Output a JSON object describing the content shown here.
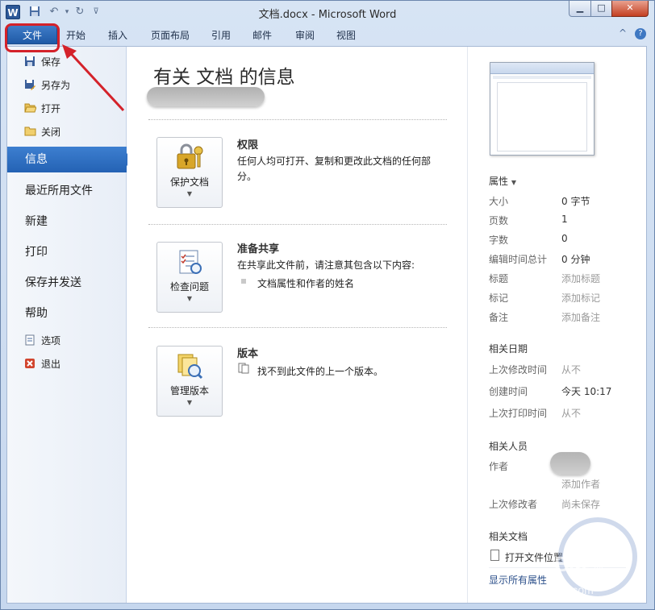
{
  "window": {
    "title": "文档.docx  -  Microsoft Word",
    "app_icon": "W",
    "qat": {
      "save_icon": "save-icon",
      "undo_icon": "undo-icon",
      "redo_icon": "redo-icon"
    },
    "controls": {
      "minimize": "▁",
      "maximize": "□",
      "close": "✕"
    }
  },
  "ribbon": {
    "tabs": [
      "文件",
      "开始",
      "插入",
      "页面布局",
      "引用",
      "邮件",
      "审阅",
      "视图"
    ],
    "help_glyph": "?",
    "collapse_glyph": "^"
  },
  "nav": {
    "small_items_top": [
      {
        "label": "保存",
        "icon": "save-icon"
      },
      {
        "label": "另存为",
        "icon": "save-as-icon"
      },
      {
        "label": "打开",
        "icon": "open-folder-icon"
      },
      {
        "label": "关闭",
        "icon": "close-folder-icon"
      }
    ],
    "big_items": [
      "信息",
      "最近所用文件",
      "新建",
      "打印",
      "保存并发送",
      "帮助"
    ],
    "active_item": "信息",
    "small_items_bottom": [
      {
        "label": "选项",
        "icon": "options-icon"
      },
      {
        "label": "退出",
        "icon": "exit-icon"
      }
    ]
  },
  "info": {
    "title": "有关 文档 的信息",
    "sections": [
      {
        "button_label": "保护文档",
        "icon": "lock-key-icon",
        "heading": "权限",
        "desc": "任何人均可打开、复制和更改此文档的任何部分。"
      },
      {
        "button_label": "检查问题",
        "icon": "checklist-icon",
        "heading": "准备共享",
        "desc": "在共享此文件前，请注意其包含以下内容:",
        "items": [
          "文档属性和作者的姓名"
        ]
      },
      {
        "button_label": "管理版本",
        "icon": "versions-icon",
        "heading": "版本",
        "desc": "找不到此文件的上一个版本。"
      }
    ]
  },
  "props": {
    "header": "属性",
    "rows": [
      {
        "label": "大小",
        "value": "0 字节",
        "muted": false
      },
      {
        "label": "页数",
        "value": "1",
        "muted": false
      },
      {
        "label": "字数",
        "value": "0",
        "muted": false
      },
      {
        "label": "编辑时间总计",
        "value": "0 分钟",
        "muted": false
      },
      {
        "label": "标题",
        "value": "添加标题",
        "muted": true
      },
      {
        "label": "标记",
        "value": "添加标记",
        "muted": true
      },
      {
        "label": "备注",
        "value": "添加备注",
        "muted": true
      }
    ],
    "dates_header": "相关日期",
    "dates": [
      {
        "label": "上次修改时间",
        "value": "从不",
        "muted": true
      },
      {
        "label": "创建时间",
        "value": "今天 10:17",
        "muted": false
      },
      {
        "label": "上次打印时间",
        "value": "从不",
        "muted": true
      }
    ],
    "people_header": "相关人员",
    "author_label": "作者",
    "add_author": "添加作者",
    "last_modified_by_label": "上次修改者",
    "last_modified_by_value": "尚未保存",
    "docs_header": "相关文档",
    "open_location": "打开文件位置",
    "show_all": "显示所有属性"
  },
  "watermark": {
    "text1": "Bai",
    "text2": "经验",
    "text3": "jingyan.baidu.com"
  },
  "colors": {
    "accent": "#2b66b8",
    "highlight": "#d4222a"
  }
}
